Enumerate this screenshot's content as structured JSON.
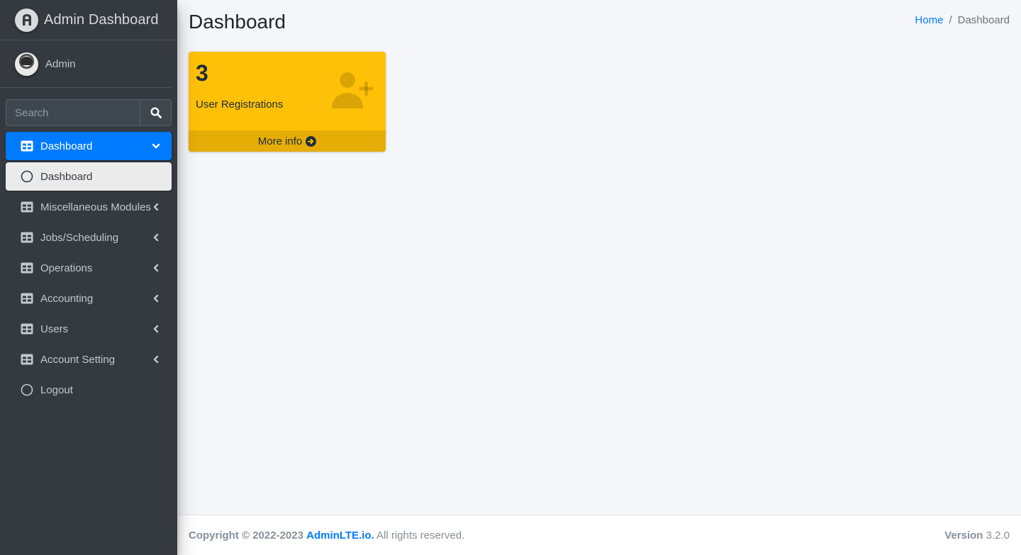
{
  "brand": {
    "title": "Admin Dashboard",
    "logo_icon": "adminlte-logo-icon"
  },
  "user": {
    "name": "Admin"
  },
  "search": {
    "placeholder": "Search"
  },
  "nav": {
    "items": [
      {
        "label": "Dashboard",
        "icon": "table-icon",
        "state": "active",
        "chevron": "down"
      },
      {
        "label": "Dashboard",
        "icon": "circle-icon",
        "state": "sub-active",
        "chevron": ""
      },
      {
        "label": "Miscellaneous Modules",
        "icon": "table-icon",
        "state": "",
        "chevron": "left"
      },
      {
        "label": "Jobs/Scheduling",
        "icon": "table-icon",
        "state": "",
        "chevron": "left"
      },
      {
        "label": "Operations",
        "icon": "table-icon",
        "state": "",
        "chevron": "left"
      },
      {
        "label": "Accounting",
        "icon": "table-icon",
        "state": "",
        "chevron": "left"
      },
      {
        "label": "Users",
        "icon": "table-icon",
        "state": "",
        "chevron": "left"
      },
      {
        "label": "Account Setting",
        "icon": "table-icon",
        "state": "",
        "chevron": "left"
      },
      {
        "label": "Logout",
        "icon": "circle-icon",
        "state": "",
        "chevron": ""
      }
    ]
  },
  "header": {
    "title": "Dashboard"
  },
  "breadcrumb": {
    "home": "Home",
    "separator": "/",
    "current": "Dashboard"
  },
  "stat_box": {
    "count": "3",
    "label": "User Registrations",
    "more": "More info",
    "icon": "user-plus-icon",
    "color": "#ffc107"
  },
  "footer": {
    "copyright": "Copyright © 2022-2023",
    "link": "AdminLTE.io.",
    "rights": "All rights reserved.",
    "version_label": "Version",
    "version": "3.2.0"
  },
  "colors": {
    "sidebar": "#343a40",
    "accent": "#007bff",
    "background": "#f4f6f9"
  }
}
